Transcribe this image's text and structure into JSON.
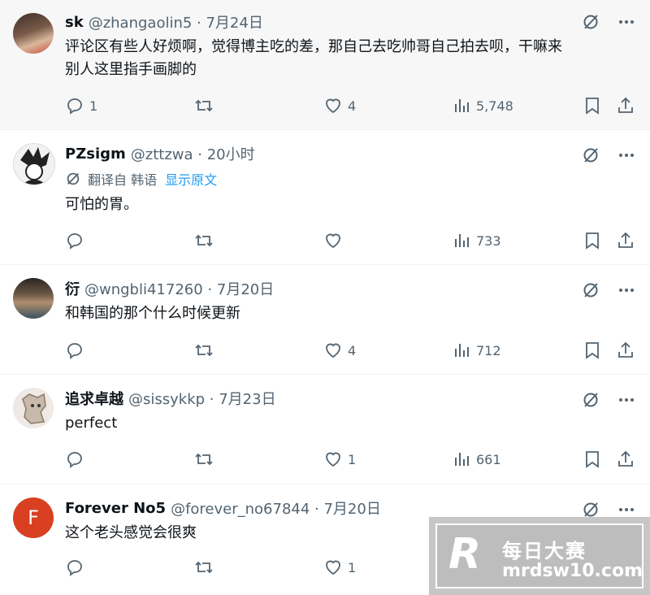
{
  "tweets": [
    {
      "name": "sk",
      "handle": "@zhangaolin5 · 7月24日",
      "text_line1": "评论区有些人好烦啊，觉得博主吃的差，那自己去吃帅哥自己拍去呗，干嘛来",
      "text_line2": "别人这里指手画脚的",
      "replies": "1",
      "retweets": "",
      "likes": "4",
      "views": "5,748"
    },
    {
      "name": "PZsigm",
      "handle": "@zttzwa · 20小时",
      "translated_label": "翻译自 韩语",
      "show_original": "显示原文",
      "text_line1": "可怕的胃。",
      "replies": "",
      "retweets": "",
      "likes": "",
      "views": "733"
    },
    {
      "name": "衍",
      "handle": "@wngbli417260 · 7月20日",
      "text_line1": "和韩国的那个什么时候更新",
      "replies": "",
      "retweets": "",
      "likes": "4",
      "views": "712"
    },
    {
      "name": "追求卓越",
      "handle": "@sissykkp · 7月23日",
      "text_line1": "perfect",
      "replies": "",
      "retweets": "",
      "likes": "1",
      "views": "661"
    },
    {
      "name": "Forever No5",
      "handle": "@forever_no67844 · 7月20日",
      "avatar_letter": "F",
      "text_line1": "这个老头感觉会很爽",
      "replies": "",
      "retweets": "",
      "likes": "1",
      "views": ""
    }
  ],
  "watermark": {
    "logo": "R",
    "line1": "每日大赛",
    "line2": "mrdsw10.com"
  },
  "colors": {
    "text": "#0f1419",
    "meta": "#536471",
    "link": "#1d9bf0",
    "avatar_f": "#d93f21"
  }
}
